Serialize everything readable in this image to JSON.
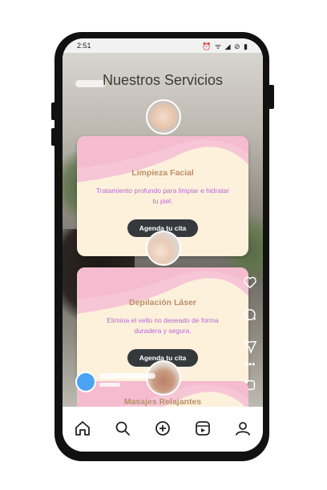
{
  "status_bar": {
    "time": "2:51",
    "icons": "⏰ ᯤ ◢ ⊘ ▮"
  },
  "page_title": "Nuestros Servicios",
  "services": [
    {
      "title": "Limpieza Facial",
      "description": "Tratamiento profundo para limpiar e hidratar tu piel.",
      "button": "Agenda tu cita"
    },
    {
      "title": "Depilación Láser",
      "description": "Elimina el vello no deseado de forma duradera y segura.",
      "button": "Agenda tu cita"
    },
    {
      "title": "Masajes Relajantes"
    }
  ],
  "side_actions": [
    "heart-icon",
    "comment-icon",
    "send-icon",
    "more-icon",
    "square-icon"
  ],
  "nav": [
    "home-icon",
    "search-icon",
    "create-icon",
    "reels-icon",
    "profile-icon"
  ],
  "colors": {
    "card_bg": "#fdf1dc",
    "wave_pink": "#f7c6d6",
    "button_bg": "#35393c",
    "title_color": "#b7906a",
    "desc_color": "#b66bd0",
    "reel_avatar": "#4aa3f5"
  }
}
